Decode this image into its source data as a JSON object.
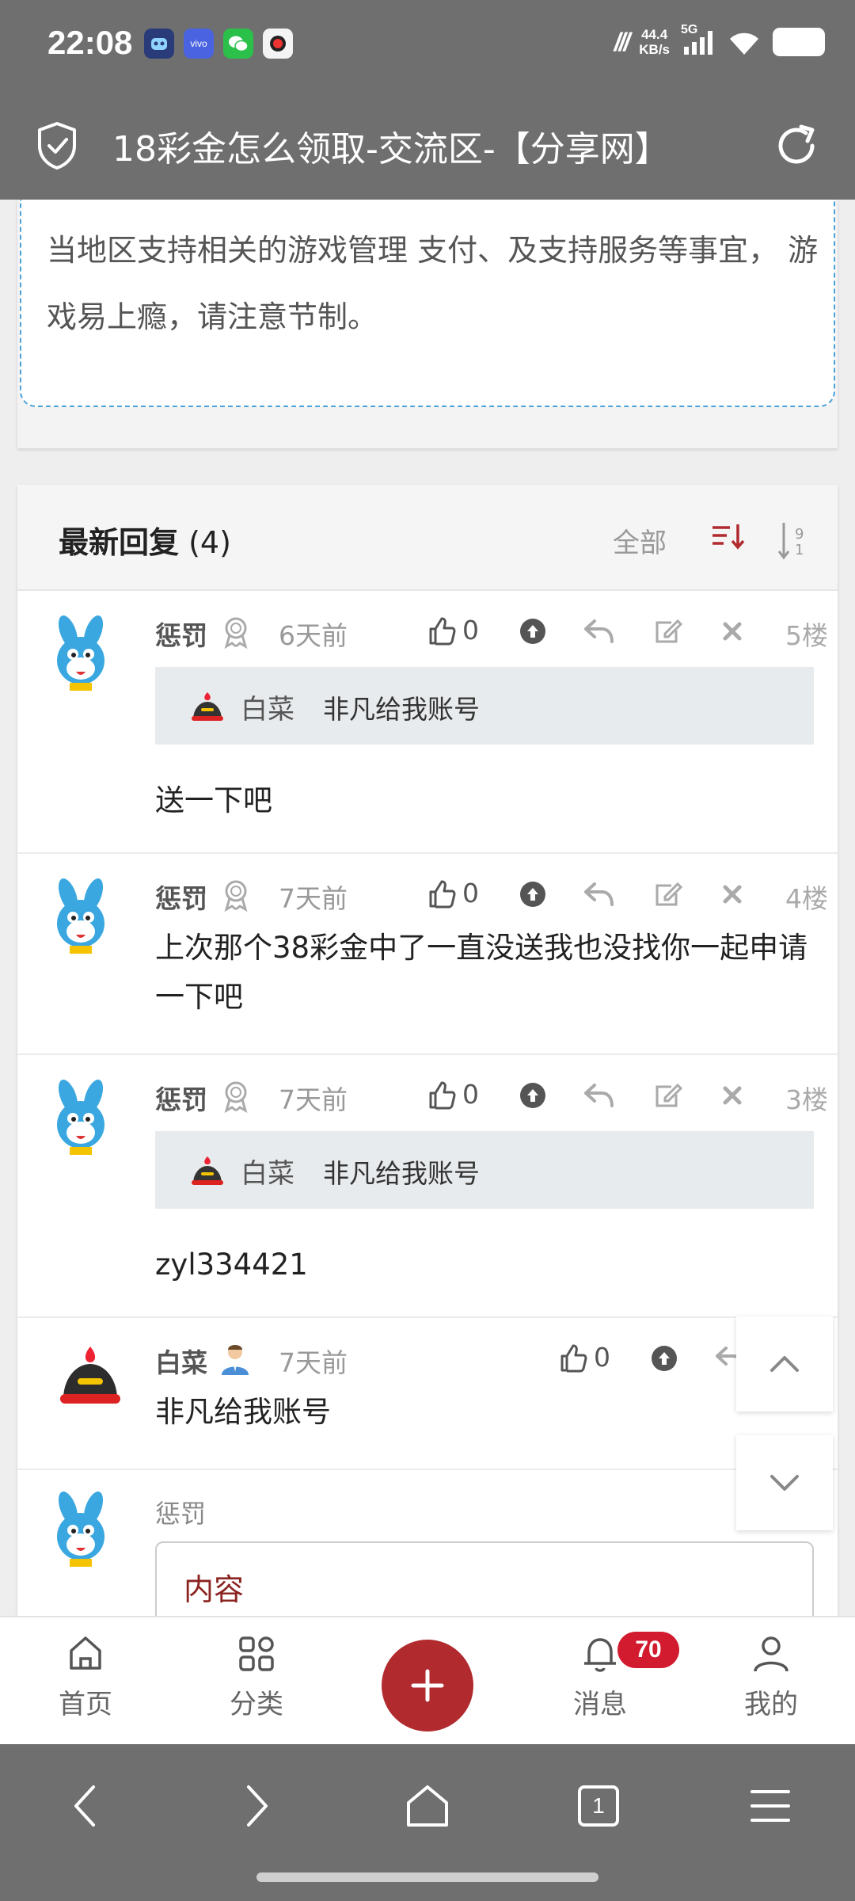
{
  "status_bar": {
    "time": "22:08",
    "apps": [
      "vivo",
      "wechat"
    ],
    "speed_value": "44.4",
    "speed_unit": "KB/s",
    "network": "5G"
  },
  "browser": {
    "title": "18彩金怎么领取-交流区-【分享网】"
  },
  "notice": {
    "text": "当地区支持相关的游戏管理 支付、及支持服务等事宜， 游戏易上瘾，请注意节制。"
  },
  "replies": {
    "title": "最新回复",
    "count": "(4)",
    "filter_label": "全部",
    "items": [
      {
        "user": "惩罚",
        "time": "6天前",
        "likes": "0",
        "floor": "5楼",
        "quote_user": "白菜",
        "quote_text": "非凡给我账号",
        "text": "送一下吧"
      },
      {
        "user": "惩罚",
        "time": "7天前",
        "likes": "0",
        "floor": "4楼",
        "text": "上次那个38彩金中了一直没送我也没找你一起申请一下吧"
      },
      {
        "user": "惩罚",
        "time": "7天前",
        "likes": "0",
        "floor": "3楼",
        "quote_user": "白菜",
        "quote_text": "非凡给我账号",
        "text": "zyl334421"
      },
      {
        "user": "白菜",
        "time": "7天前",
        "likes": "0",
        "text": "非凡给我账号"
      }
    ]
  },
  "composer": {
    "user": "惩罚",
    "placeholder": "内容"
  },
  "bottom_nav": {
    "home": "首页",
    "category": "分类",
    "messages": "消息",
    "messages_badge": "70",
    "mine": "我的"
  },
  "browser_nav": {
    "tab_count": "1"
  },
  "colors": {
    "accent": "#b02a2e",
    "badge": "#d21b2f",
    "chrome": "#6f6f6f",
    "notice_border": "#4aa3d8"
  }
}
